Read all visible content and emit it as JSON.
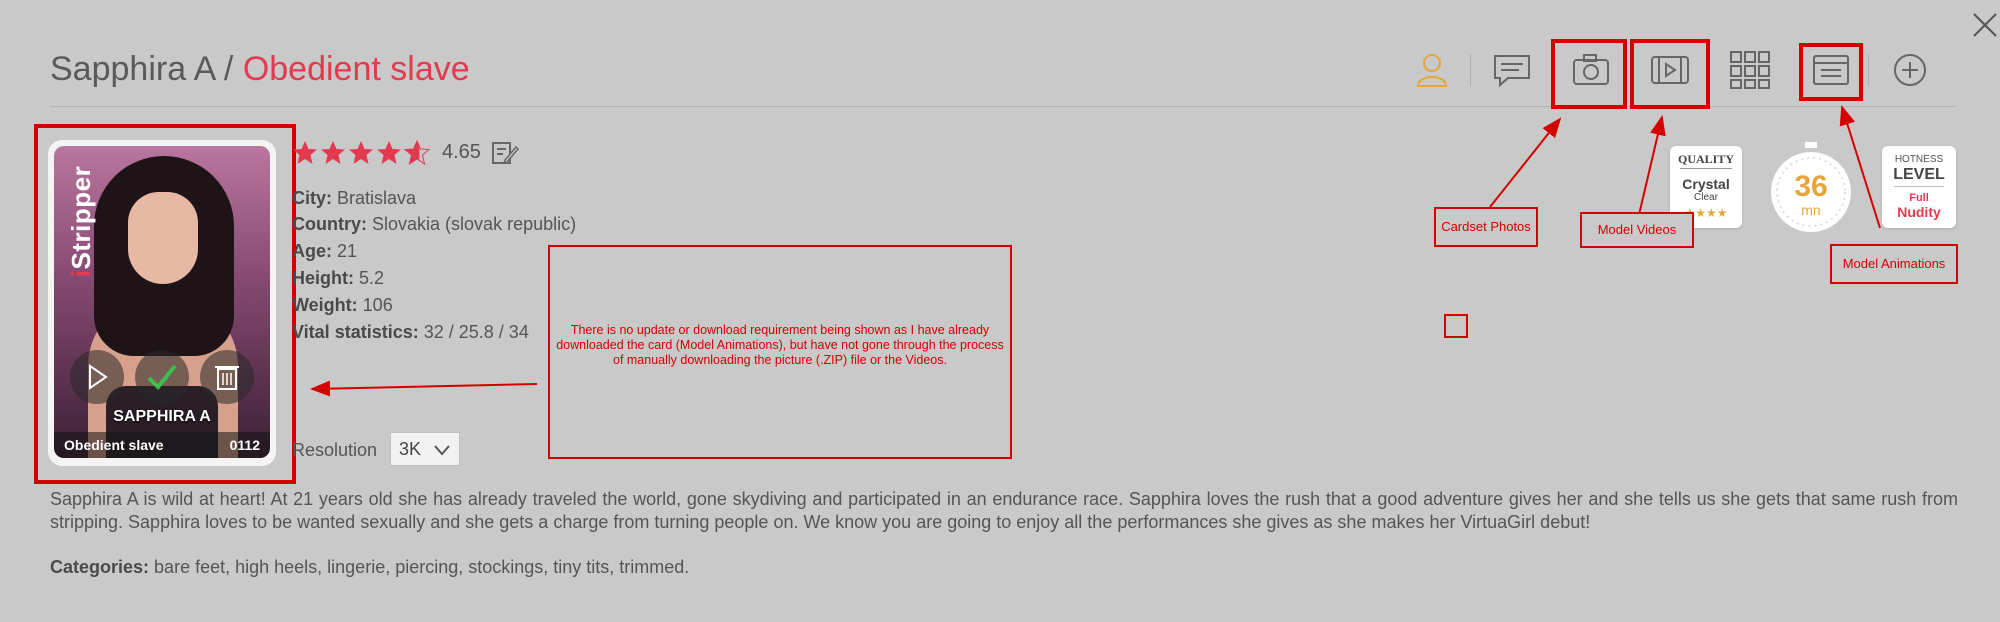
{
  "header": {
    "model_name": "Sapphira A",
    "separator": " / ",
    "card_title": "Obedient slave"
  },
  "toolbar": {
    "icons": [
      "profile-icon",
      "chat-icon",
      "camera-icon",
      "video-icon",
      "grid-icon",
      "animation-icon",
      "add-icon"
    ],
    "accent_color": "#e8a63a"
  },
  "card": {
    "brand": "iStripper",
    "name": "SAPPHIRA A",
    "subtitle": "Obedient slave",
    "number": "0112"
  },
  "rating": {
    "value": "4.65",
    "stars": 4.65
  },
  "info": {
    "city_label": "City:",
    "city": "Bratislava",
    "country_label": "Country:",
    "country": "Slovakia (slovak republic)",
    "age_label": "Age:",
    "age": "21",
    "height_label": "Height:",
    "height": "5.2",
    "weight_label": "Weight:",
    "weight": "106",
    "vital_label": "Vital statistics:",
    "vital": "32 / 25.8 / 34"
  },
  "resolution": {
    "label": "Resolution",
    "value": "3K"
  },
  "annotation": {
    "note": "There is no update or download requirement being shown as I have already downloaded the card (Model Animations), but have not gone through the process of manually downloading the picture (.ZIP) file or the Videos.",
    "cardset_photos": "Cardset Photos",
    "model_videos": "Model Videos",
    "model_animations": "Model Animations"
  },
  "badges": {
    "quality_top": "QUALITY",
    "quality_main": "Crystal",
    "quality_sub": "Clear",
    "duration_value": "36",
    "duration_unit": "mn",
    "hotness_top": "HOTNESS",
    "hotness_main": "LEVEL",
    "hotness_sub1": "Full",
    "hotness_sub2": "Nudity"
  },
  "description": "Sapphira A is wild at heart! At 21 years old she has already traveled the world, gone skydiving and participated in an endurance race. Sapphira loves the rush that a good adventure gives her and she tells us she gets that same rush from stripping. Sapphira loves to be wanted sexually and she gets a charge from turning people on. We know you are going to enjoy all the performances she gives as she makes her VirtuaGirl debut!",
  "categories": {
    "label": "Categories:",
    "value": "bare feet, high heels, lingerie, piercing, stockings, tiny tits, trimmed."
  },
  "colors": {
    "accent": "#e23a4f",
    "annotation": "#d40000",
    "background": "#c9c9c9"
  }
}
